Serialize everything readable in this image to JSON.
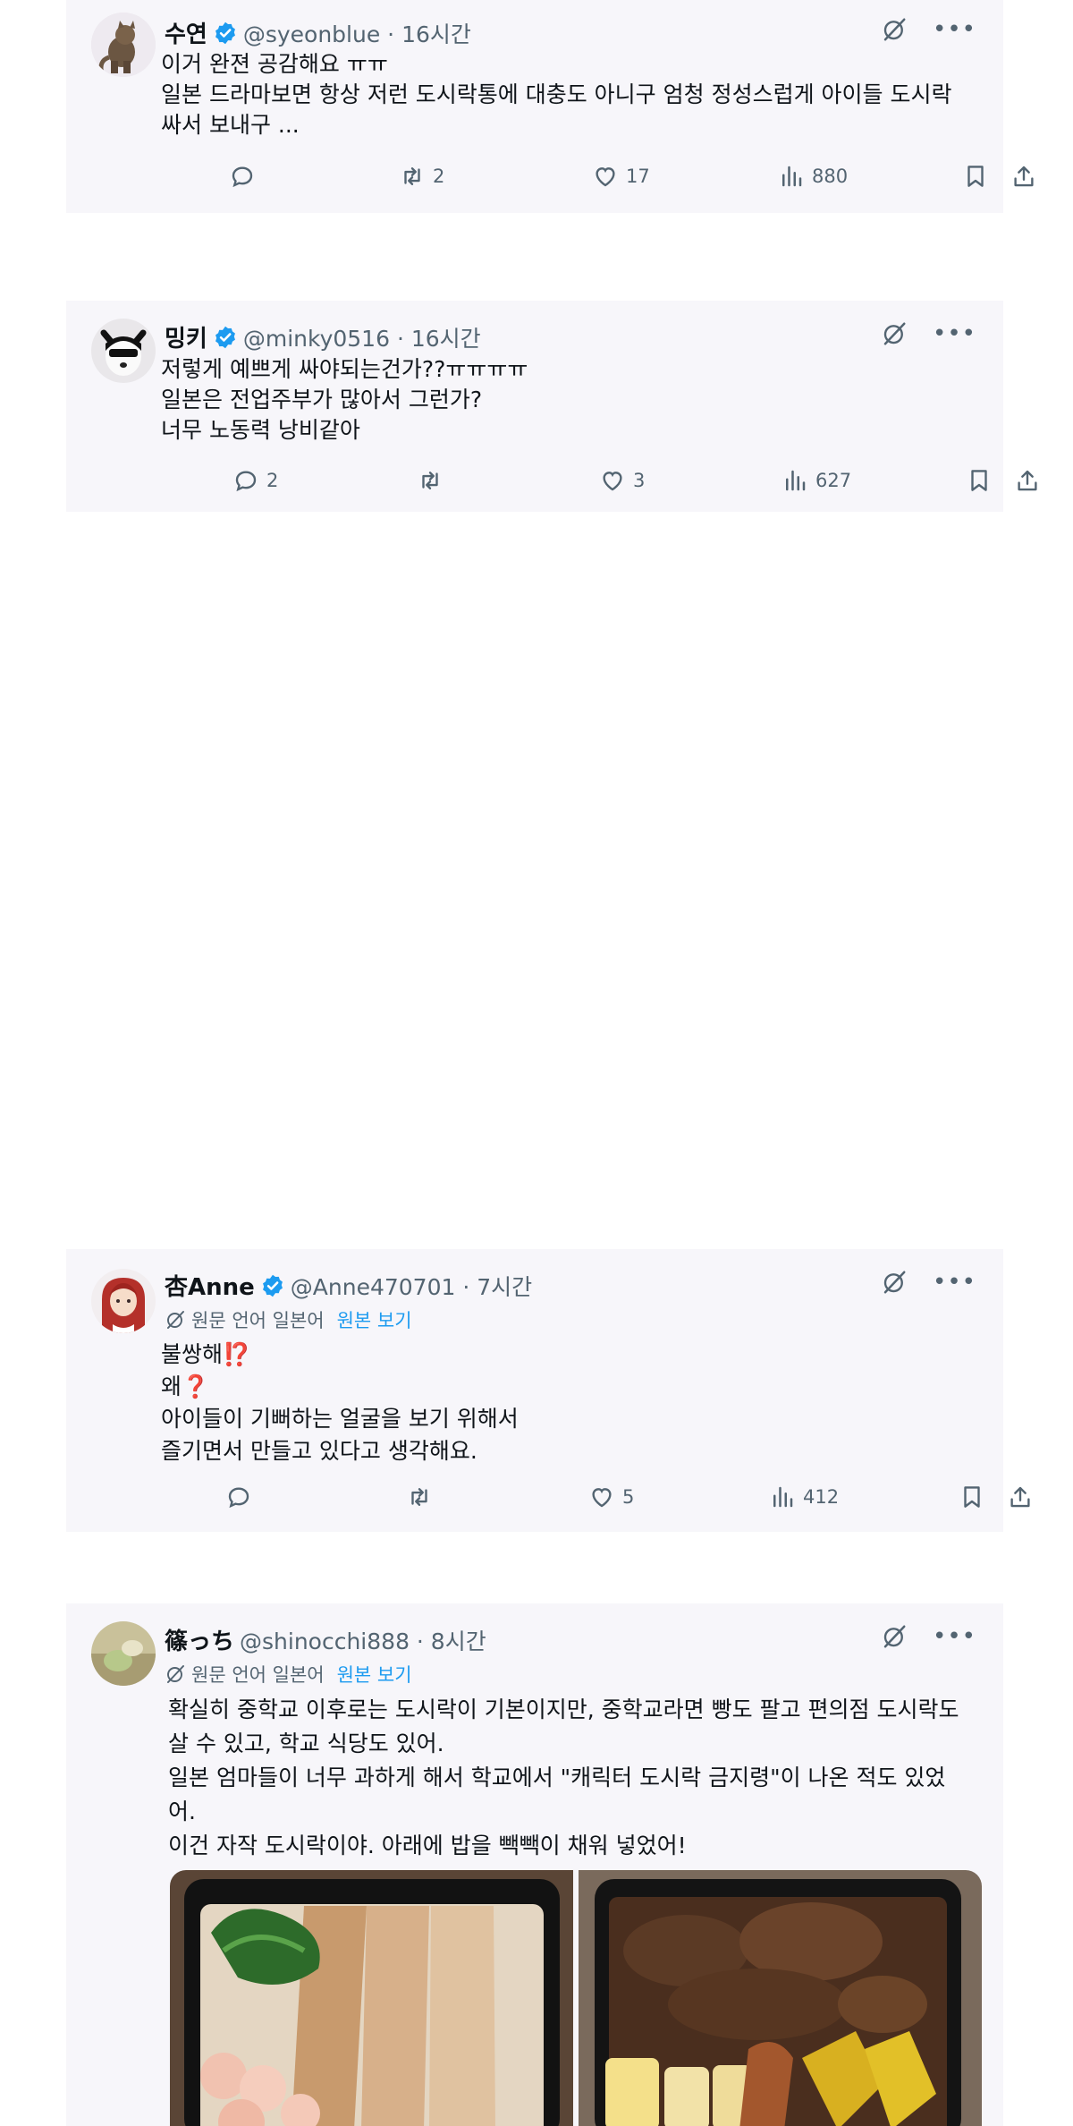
{
  "tweets": [
    {
      "name": "수연",
      "handle": "@syeonblue · 16시간",
      "lines": [
        "이거 완젼 공감해요 ㅠㅠ",
        "일본 드라마보면 항상 저런 도시락통에 대충도 아니구 엄청 정성스럽게 아이들 도시락",
        "싸서 보내구 ..."
      ],
      "reply_count": "",
      "retweet_count": "2",
      "like_count": "17",
      "view_count": "880"
    },
    {
      "name": "밍키",
      "handle": "@minky0516 · 16시간",
      "lines": [
        "저렇게 예쁘게 싸야되는건가??ㅠㅠㅠㅠ",
        "일본은 전업주부가 많아서 그런가?",
        "너무 노동력 낭비같아"
      ],
      "reply_count": "2",
      "retweet_count": "",
      "like_count": "3",
      "view_count": "627"
    },
    {
      "name": "杏Anne",
      "handle": "@Anne470701 · 7시간",
      "translate_note": "원문 언어 일본어",
      "translate_link": "원본 보기",
      "lines": [
        "불쌍해⁉️",
        "왜❓",
        "아이들이 기뻐하는 얼굴을 보기 위해서",
        "즐기면서 만들고 있다고 생각해요."
      ],
      "reply_count": "",
      "retweet_count": "",
      "like_count": "5",
      "view_count": "412"
    },
    {
      "name": "篠っち",
      "handle": "@shinocchi888 · 8시간",
      "translate_note": "원문 언어 일본어",
      "translate_link": "원본 보기",
      "lines": [
        "확실히 중학교 이후로는 도시락이 기본이지만, 중학교라면 빵도 팔고 편의점 도시락도",
        "살 수 있고, 학교 식당도 있어.",
        "일본 엄마들이 너무 과하게 해서 학교에서 \"캐릭터 도시락 금지령\"이 나온 적도 있었",
        "어.",
        "이건 자작 도시락이야. 아래에 밥을 빽빽이 채워 넣었어!"
      ]
    }
  ],
  "icons": {
    "reply": "reply-icon",
    "retweet": "retweet-icon",
    "like": "heart-icon",
    "views": "views-icon",
    "bookmark": "bookmark-icon",
    "share": "share-icon",
    "grok": "grok-icon",
    "more": "more-icon",
    "verified": "verified-badge-icon"
  },
  "colors": {
    "card_bg": "#f7f6fa",
    "verified": "#1d9bf0",
    "muted": "#536471",
    "link": "#1d9bf0"
  }
}
